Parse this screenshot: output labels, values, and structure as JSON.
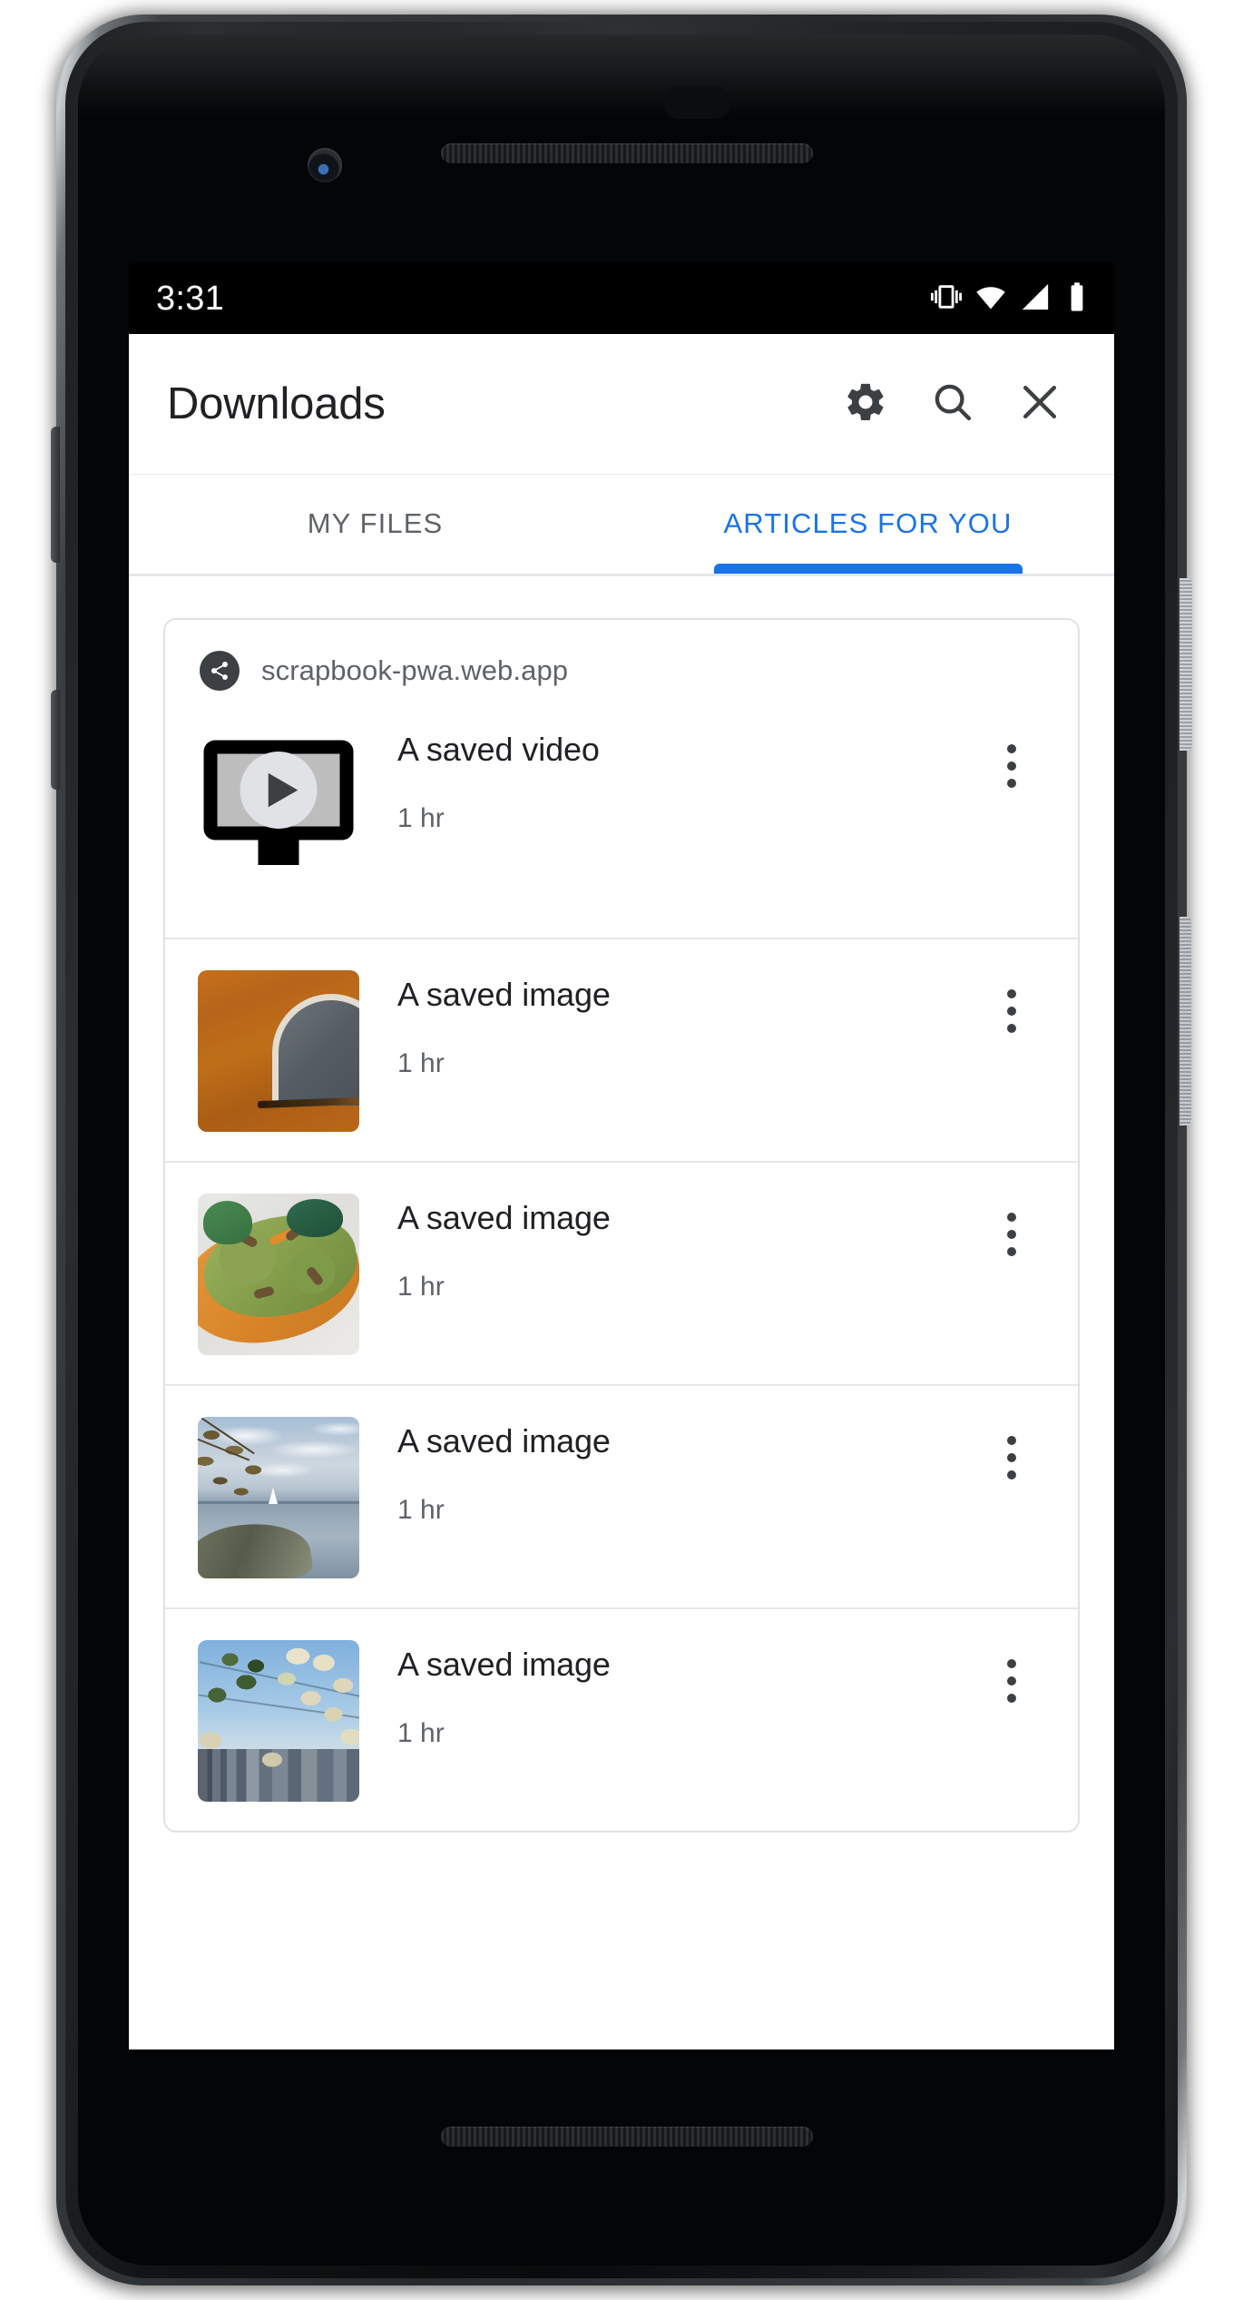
{
  "status_bar": {
    "time": "3:31",
    "icons": [
      "vibrate-icon",
      "wifi-icon",
      "signal-icon",
      "battery-icon"
    ]
  },
  "toolbar": {
    "title": "Downloads",
    "actions": [
      {
        "name": "settings-button",
        "icon": "gear-icon"
      },
      {
        "name": "search-button",
        "icon": "search-icon"
      },
      {
        "name": "close-button",
        "icon": "close-icon"
      }
    ]
  },
  "tabs": {
    "items": [
      {
        "label": "MY FILES",
        "active": false
      },
      {
        "label": "ARTICLES FOR YOU",
        "active": true
      }
    ],
    "active_color": "#1a73e8",
    "inactive_color": "#5f6368"
  },
  "card": {
    "origin": "scrapbook-pwa.web.app",
    "origin_icon": "share-icon",
    "items": [
      {
        "title": "A saved video",
        "subtitle": "1 hr",
        "thumb": "video-placeholder-icon",
        "menu_icon": "more-vert-icon"
      },
      {
        "title": "A saved image",
        "subtitle": "1 hr",
        "thumb": "orange-wall-window-photo",
        "menu_icon": "more-vert-icon"
      },
      {
        "title": "A saved image",
        "subtitle": "1 hr",
        "thumb": "avocado-toast-photo",
        "menu_icon": "more-vert-icon"
      },
      {
        "title": "A saved image",
        "subtitle": "1 hr",
        "thumb": "lake-shoreline-sailboat-photo",
        "menu_icon": "more-vert-icon"
      },
      {
        "title": "A saved image",
        "subtitle": "1 hr",
        "thumb": "city-skyline-blossoms-photo",
        "menu_icon": "more-vert-icon"
      }
    ]
  },
  "colors": {
    "accent": "#1a73e8",
    "text_primary": "#202124",
    "text_secondary": "#5f6368",
    "divider": "#e6e8ea",
    "surface": "#ffffff"
  }
}
